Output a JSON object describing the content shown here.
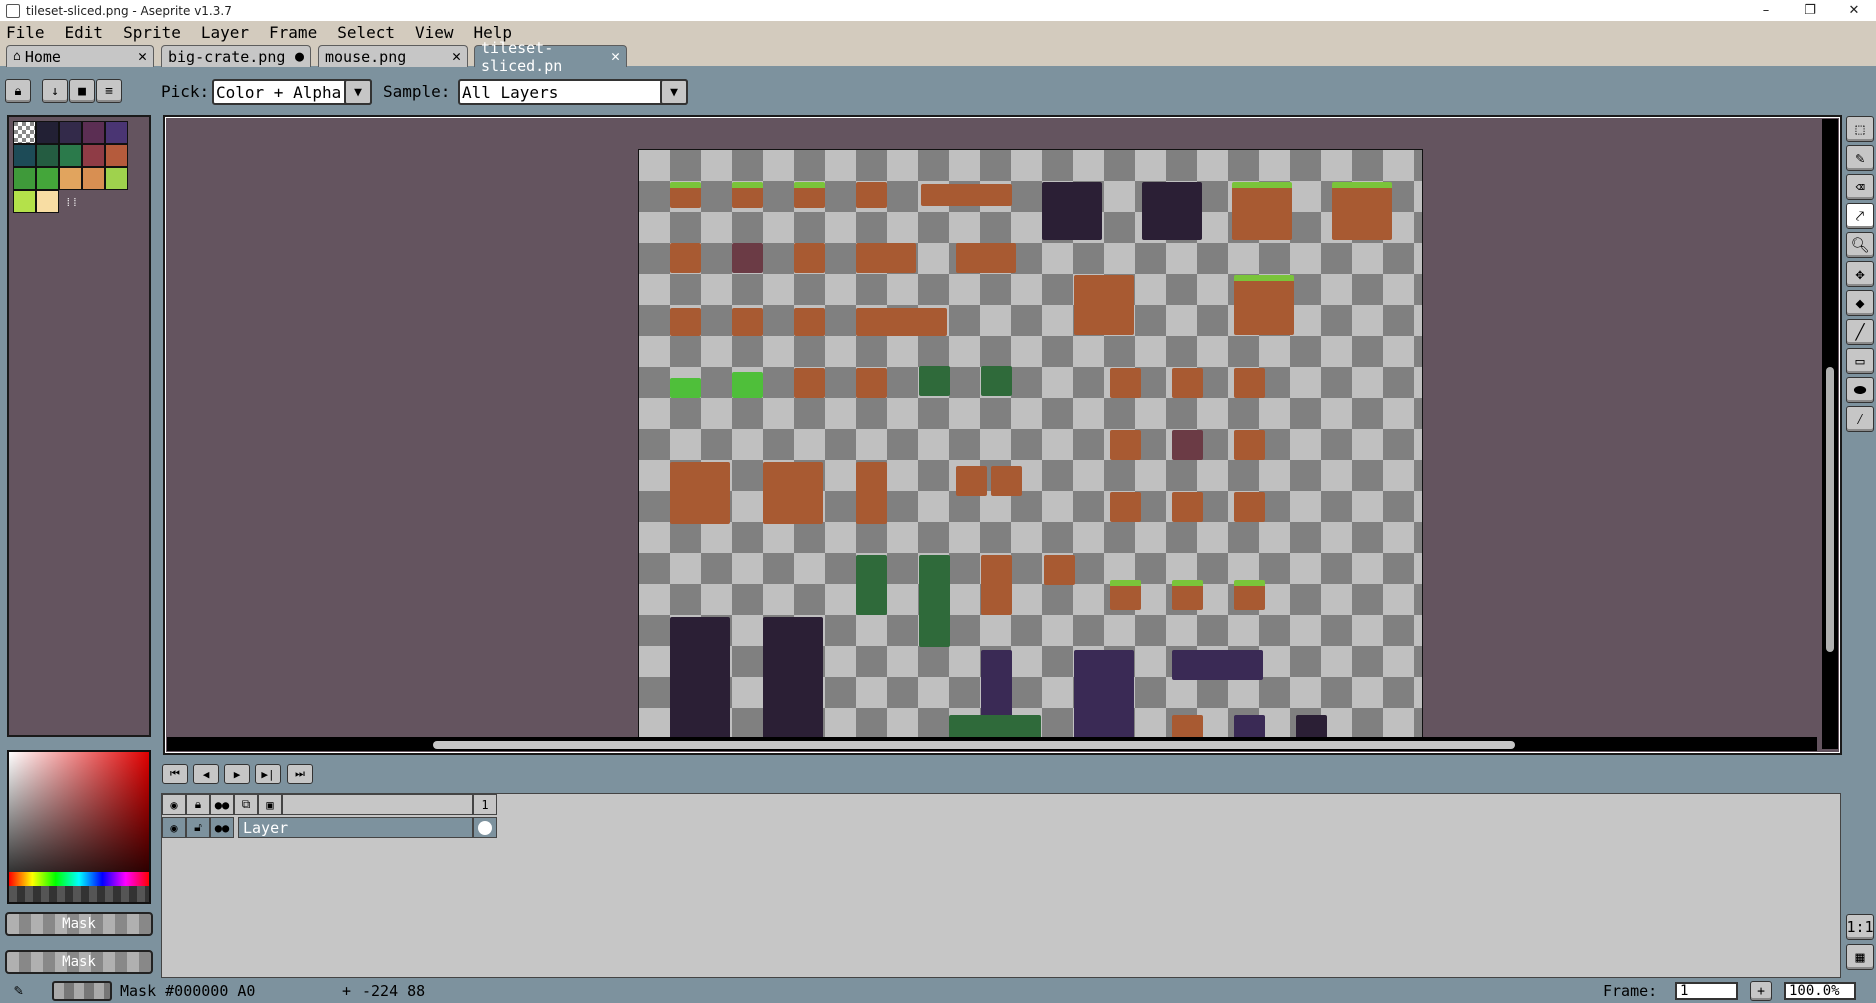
{
  "window": {
    "title": "tileset-sliced.png - Aseprite v1.3.7",
    "minimize": "–",
    "maximize": "❐",
    "close": "✕"
  },
  "menu": [
    "File",
    "Edit",
    "Sprite",
    "Layer",
    "Frame",
    "Select",
    "View",
    "Help"
  ],
  "tabs": [
    {
      "label": "Home",
      "marker": "✕"
    },
    {
      "label": "big-crate.png",
      "marker": "●"
    },
    {
      "label": "mouse.png",
      "marker": "✕"
    },
    {
      "label": "tileset-sliced.pn",
      "marker": "✕"
    }
  ],
  "options": {
    "pick_label": "Pick:",
    "pick_value": "Color + Alpha",
    "sample_label": "Sample:",
    "sample_value": "All Layers"
  },
  "palette": {
    "colors": [
      "#222034",
      "#332a4a",
      "#5b2e53",
      "#4a3573",
      "#1d4b57",
      "#245c41",
      "#2b7a4b",
      "#8f3c46",
      "#b55b3c",
      "#3f9a3a",
      "#44a63a",
      "#e1a45e",
      "#d88f52",
      "#9fd24d",
      "#b4e14a",
      "#f8dda3"
    ],
    "extra_marker": "⁞⁞"
  },
  "mask_buttons": [
    "Mask",
    "Mask"
  ],
  "timeline": {
    "frame_number": "1",
    "layer_name": "Layer"
  },
  "status": {
    "mask_info": "Mask #000000 A0",
    "cursor_icon": "+",
    "coords": "-224 88",
    "frame_label": "Frame:",
    "frame_value": "1",
    "zoom": "100.0%"
  },
  "right_tools": [
    "rectangular-marquee",
    "pencil",
    "eraser",
    "eyedropper",
    "zoom",
    "move",
    "paint-bucket",
    "line",
    "rectangle",
    "contour",
    "blur"
  ],
  "bottom_right": {
    "ratio": "1:1"
  }
}
